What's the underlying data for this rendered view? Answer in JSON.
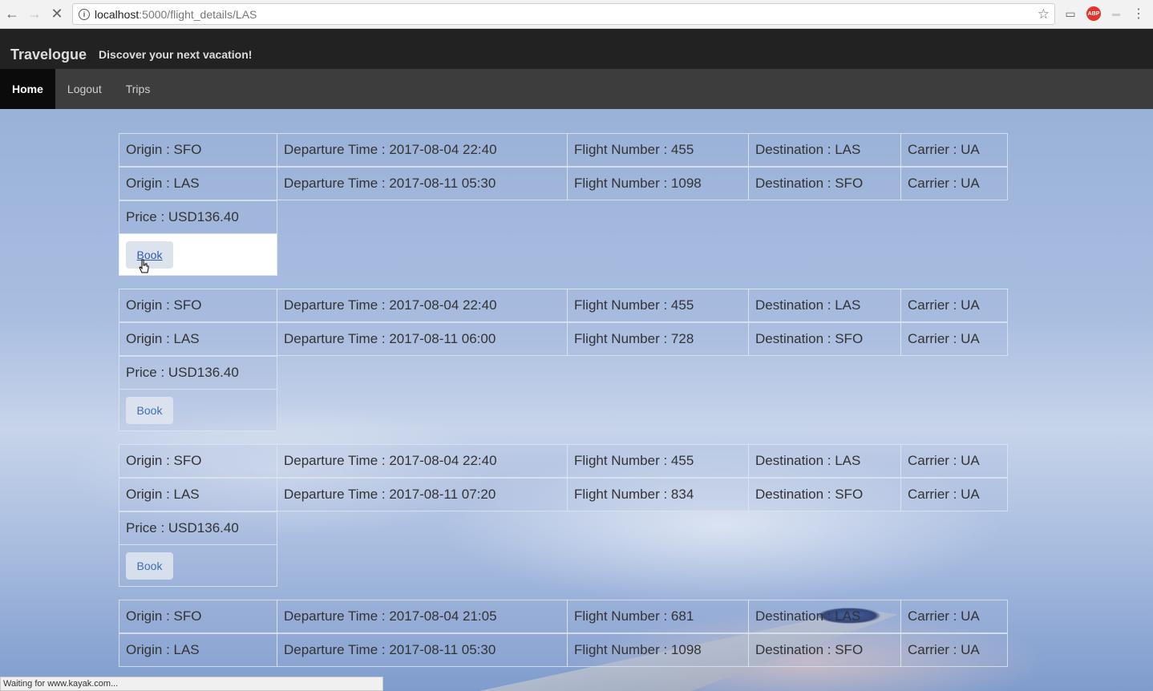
{
  "browser": {
    "url_host": "localhost",
    "url_path": ":5000/flight_details/LAS",
    "status_text": "Waiting for www.kayak.com..."
  },
  "header": {
    "brand": "Travelogue",
    "tagline": "Discover your next vacation!"
  },
  "nav": {
    "items": [
      {
        "label": "Home",
        "active": true
      },
      {
        "label": "Logout",
        "active": false
      },
      {
        "label": "Trips",
        "active": false
      }
    ]
  },
  "flights": [
    {
      "legs": [
        {
          "origin": "Origin : SFO",
          "departure": "Departure Time : 2017-08-04 22:40",
          "flight": "Flight Number : 455",
          "destination": "Destination : LAS",
          "carrier": "Carrier : UA"
        },
        {
          "origin": "Origin : LAS",
          "departure": "Departure Time : 2017-08-11 05:30",
          "flight": "Flight Number : 1098",
          "destination": "Destination : SFO",
          "carrier": "Carrier : UA"
        }
      ],
      "price": "Price : USD136.40",
      "book_label": "Book"
    },
    {
      "legs": [
        {
          "origin": "Origin : SFO",
          "departure": "Departure Time : 2017-08-04 22:40",
          "flight": "Flight Number : 455",
          "destination": "Destination : LAS",
          "carrier": "Carrier : UA"
        },
        {
          "origin": "Origin : LAS",
          "departure": "Departure Time : 2017-08-11 06:00",
          "flight": "Flight Number : 728",
          "destination": "Destination : SFO",
          "carrier": "Carrier : UA"
        }
      ],
      "price": "Price : USD136.40",
      "book_label": "Book"
    },
    {
      "legs": [
        {
          "origin": "Origin : SFO",
          "departure": "Departure Time : 2017-08-04 22:40",
          "flight": "Flight Number : 455",
          "destination": "Destination : LAS",
          "carrier": "Carrier : UA"
        },
        {
          "origin": "Origin : LAS",
          "departure": "Departure Time : 2017-08-11 07:20",
          "flight": "Flight Number : 834",
          "destination": "Destination : SFO",
          "carrier": "Carrier : UA"
        }
      ],
      "price": "Price : USD136.40",
      "book_label": "Book"
    },
    {
      "legs": [
        {
          "origin": "Origin : SFO",
          "departure": "Departure Time : 2017-08-04 21:05",
          "flight": "Flight Number : 681",
          "destination": "Destination : LAS",
          "carrier": "Carrier : UA"
        },
        {
          "origin": "Origin : LAS",
          "departure": "Departure Time : 2017-08-11 05:30",
          "flight": "Flight Number : 1098",
          "destination": "Destination : SFO",
          "carrier": "Carrier : UA"
        }
      ]
    }
  ]
}
